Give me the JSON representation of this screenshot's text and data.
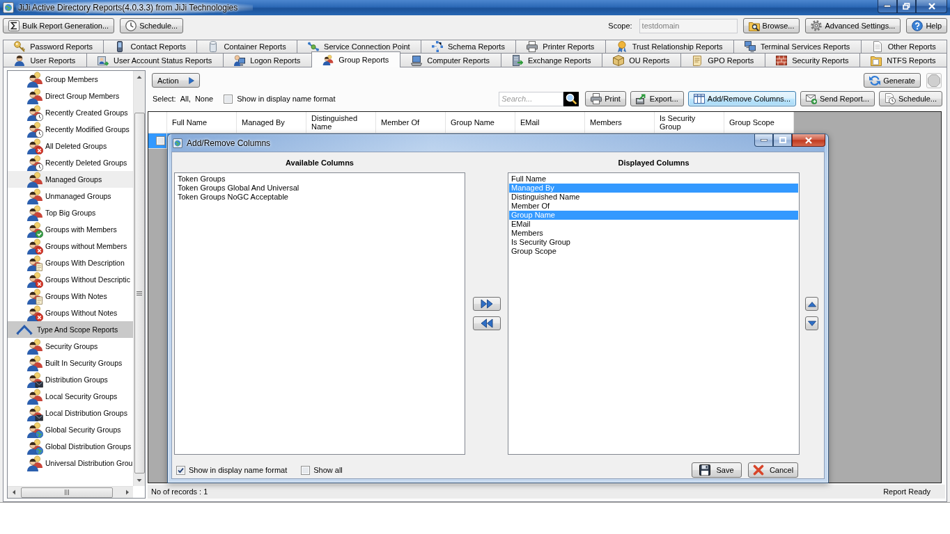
{
  "window": {
    "title": "JiJi Active Directory Reports(4.0.3.3) from JiJi Technologies"
  },
  "toolbar": {
    "left_buttons": [
      "Bulk Report Generation...",
      "Schedule..."
    ],
    "scope": {
      "label": "Scope:",
      "value": "testdomain",
      "disabled": true
    },
    "right_buttons": [
      "Browse...",
      "Advanced Settings...",
      "Help"
    ]
  },
  "tab_rows": [
    [
      {
        "label": "Password Reports",
        "selected": false
      },
      {
        "label": "Contact Reports",
        "selected": false
      },
      {
        "label": "Container Reports",
        "selected": false
      },
      {
        "label": "Service Connection Point",
        "selected": false
      },
      {
        "label": "Schema Reports",
        "selected": false
      },
      {
        "label": "Printer Reports",
        "selected": false
      },
      {
        "label": "Trust Relationship Reports",
        "selected": false
      },
      {
        "label": "Terminal Services Reports",
        "selected": false
      },
      {
        "label": "Other Reports",
        "selected": false
      }
    ],
    [
      {
        "label": "User Reports",
        "selected": false
      },
      {
        "label": "User Account Status Reports",
        "selected": false
      },
      {
        "label": "Logon Reports",
        "selected": false
      },
      {
        "label": "Group Reports",
        "selected": true
      },
      {
        "label": "Computer Reports",
        "selected": false
      },
      {
        "label": "Exchange Reports",
        "selected": false
      },
      {
        "label": "OU Reports",
        "selected": false
      },
      {
        "label": "GPO Reports",
        "selected": false
      },
      {
        "label": "Security Reports",
        "selected": false
      },
      {
        "label": "NTFS Reports",
        "selected": false
      }
    ]
  ],
  "sidebar": {
    "items": [
      {
        "kind": "report",
        "label": "Group Members",
        "selected": false
      },
      {
        "kind": "report",
        "label": "Direct Group Members",
        "selected": false
      },
      {
        "kind": "report",
        "label": "Recently Created Groups",
        "selected": false
      },
      {
        "kind": "report",
        "label": "Recently Modified Groups",
        "selected": false
      },
      {
        "kind": "report",
        "label": "All Deleted Groups",
        "selected": false
      },
      {
        "kind": "report",
        "label": "Recently Deleted Groups",
        "selected": false
      },
      {
        "kind": "report",
        "label": "Managed Groups",
        "selected": true
      },
      {
        "kind": "report",
        "label": "Unmanaged Groups",
        "selected": false
      },
      {
        "kind": "report",
        "label": "Top Big Groups",
        "selected": false
      },
      {
        "kind": "report",
        "label": "Groups with Members",
        "selected": false
      },
      {
        "kind": "report",
        "label": "Groups without Members",
        "selected": false
      },
      {
        "kind": "report",
        "label": "Groups With Description",
        "selected": false
      },
      {
        "kind": "report",
        "label": "Groups Without Descriptic",
        "selected": false
      },
      {
        "kind": "report",
        "label": "Groups With Notes",
        "selected": false
      },
      {
        "kind": "report",
        "label": "Groups Without Notes",
        "selected": false
      },
      {
        "kind": "section",
        "label": "Type And Scope Reports",
        "expanded": true,
        "children": [
          {
            "kind": "report",
            "label": "Security Groups",
            "selected": false
          },
          {
            "kind": "report",
            "label": "Built In Security Groups",
            "selected": false
          },
          {
            "kind": "report",
            "label": "Distribution Groups",
            "selected": false
          },
          {
            "kind": "report",
            "label": "Local Security Groups",
            "selected": false
          },
          {
            "kind": "report",
            "label": "Local Distribution Groups",
            "selected": false
          },
          {
            "kind": "report",
            "label": "Global Security Groups",
            "selected": false
          },
          {
            "kind": "report",
            "label": "Global Distribution Groups",
            "selected": false
          },
          {
            "kind": "report",
            "label": "Universal Distribution Grou",
            "selected": false
          }
        ]
      }
    ]
  },
  "report": {
    "action_button": "Action",
    "generate_button": "Generate",
    "stop_button": {
      "disabled": true
    },
    "select_label": "Select:",
    "select_links": [
      "All,",
      "None"
    ],
    "display_name_option": {
      "label": "Show in display name format",
      "checked": false
    },
    "search": {
      "placeholder": "Search..."
    },
    "buttons": [
      {
        "label": "Print",
        "focused": false
      },
      {
        "label": "Export...",
        "focused": false
      },
      {
        "label": "Add/Remove Columns...",
        "focused": true
      },
      {
        "label": "Send Report...",
        "focused": false
      },
      {
        "label": "Schedule...",
        "focused": false
      }
    ],
    "table": {
      "columns": [
        "Full Name",
        "Managed By",
        "Distinguished Name",
        "Member Of",
        "Group Name",
        "EMail",
        "Members",
        "Is Security Group",
        "Group Scope"
      ],
      "rows": [
        {
          "checked": false,
          "selected": true
        }
      ]
    },
    "status_bar": {
      "records": "No of records : 1",
      "state": "Report Ready"
    }
  },
  "dialog": {
    "title": "Add/Remove Columns",
    "available": {
      "title": "Available Columns",
      "items": [
        {
          "label": "Token Groups",
          "selected": false
        },
        {
          "label": "Token Groups Global And Universal",
          "selected": false
        },
        {
          "label": "Token Groups NoGC Acceptable",
          "selected": false
        }
      ]
    },
    "displayed": {
      "title": "Displayed Columns",
      "items": [
        {
          "label": "Full Name",
          "selected": false
        },
        {
          "label": "Managed By",
          "selected": true
        },
        {
          "label": "Distinguished Name",
          "selected": false
        },
        {
          "label": "Member Of",
          "selected": false
        },
        {
          "label": "Group Name",
          "selected": true
        },
        {
          "label": "EMail",
          "selected": false
        },
        {
          "label": "Members",
          "selected": false
        },
        {
          "label": "Is Security Group",
          "selected": false
        },
        {
          "label": "Group Scope",
          "selected": false
        }
      ]
    },
    "options": [
      {
        "label": "Show in display name format",
        "checked": true
      },
      {
        "label": "Show all",
        "checked": false
      }
    ],
    "buttons": [
      "Save",
      "Cancel"
    ]
  }
}
